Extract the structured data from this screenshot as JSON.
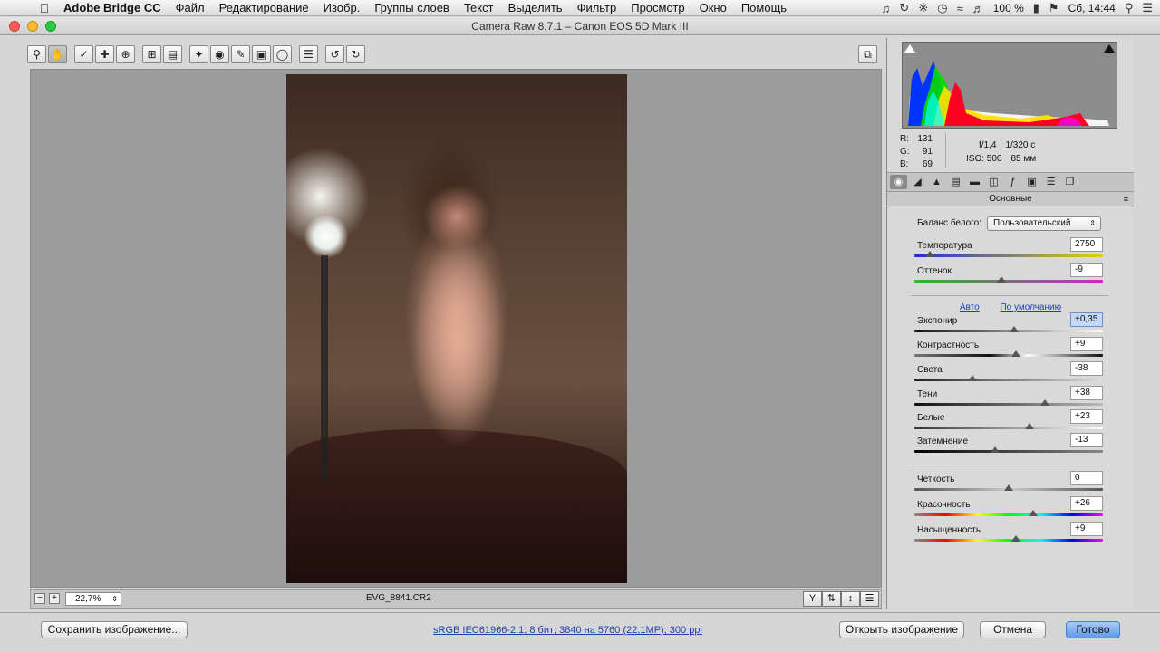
{
  "menubar": {
    "app_name": "Adobe Bridge CC",
    "items": [
      "Файл",
      "Редактирование",
      "Изобр.",
      "Группы слоев",
      "Текст",
      "Выделить",
      "Фильтр",
      "Просмотр",
      "Окно",
      "Помощь"
    ],
    "battery": "100 %",
    "clock": "Сб, 14:44"
  },
  "window": {
    "title": "Camera Raw 8.7.1  –  Canon EOS 5D Mark III"
  },
  "preview": {
    "zoom": "22,7%",
    "filename": "EVG_8841.CR2"
  },
  "readout": {
    "r_label": "R:",
    "r_value": "131",
    "g_label": "G:",
    "g_value": "91",
    "b_label": "B:",
    "b_value": "69",
    "aperture": "f/1,4",
    "shutter": "1/320 с",
    "iso": "ISO: 500",
    "focal": "85 мм"
  },
  "panel": {
    "section_title": "Основные",
    "wb_label": "Баланс белого:",
    "wb_value": "Пользовательский",
    "link_auto": "Авто",
    "link_default": "По умолчанию",
    "sliders": [
      {
        "label": "Температура",
        "value": "2750",
        "pos": 0.08
      },
      {
        "label": "Оттенок",
        "value": "-9",
        "pos": 0.46
      },
      {
        "label": "Экспонир",
        "value": "+0,35",
        "pos": 0.53,
        "highlight": true
      },
      {
        "label": "Контрастность",
        "value": "+9",
        "pos": 0.54
      },
      {
        "label": "Света",
        "value": "-38",
        "pos": 0.31
      },
      {
        "label": "Тени",
        "value": "+38",
        "pos": 0.69
      },
      {
        "label": "Белые",
        "value": "+23",
        "pos": 0.61
      },
      {
        "label": "Затемнение",
        "value": "-13",
        "pos": 0.43
      },
      {
        "label": "Четкость",
        "value": "0",
        "pos": 0.5
      },
      {
        "label": "Красочность",
        "value": "+26",
        "pos": 0.63
      },
      {
        "label": "Насыщенность",
        "value": "+9",
        "pos": 0.54
      }
    ]
  },
  "bottom": {
    "save_label": "Сохранить изображение...",
    "info_link": "sRGB IEC61966-2.1; 8 бит; 3840 на 5760 (22,1MP); 300 ppi",
    "open_label": "Открыть изображение",
    "cancel_label": "Отмена",
    "done_label": "Готово"
  },
  "colors": {
    "accent_blue": "#5e9ae8",
    "link_blue": "#1f3fae",
    "preview_bg": "#9c9c9c"
  }
}
